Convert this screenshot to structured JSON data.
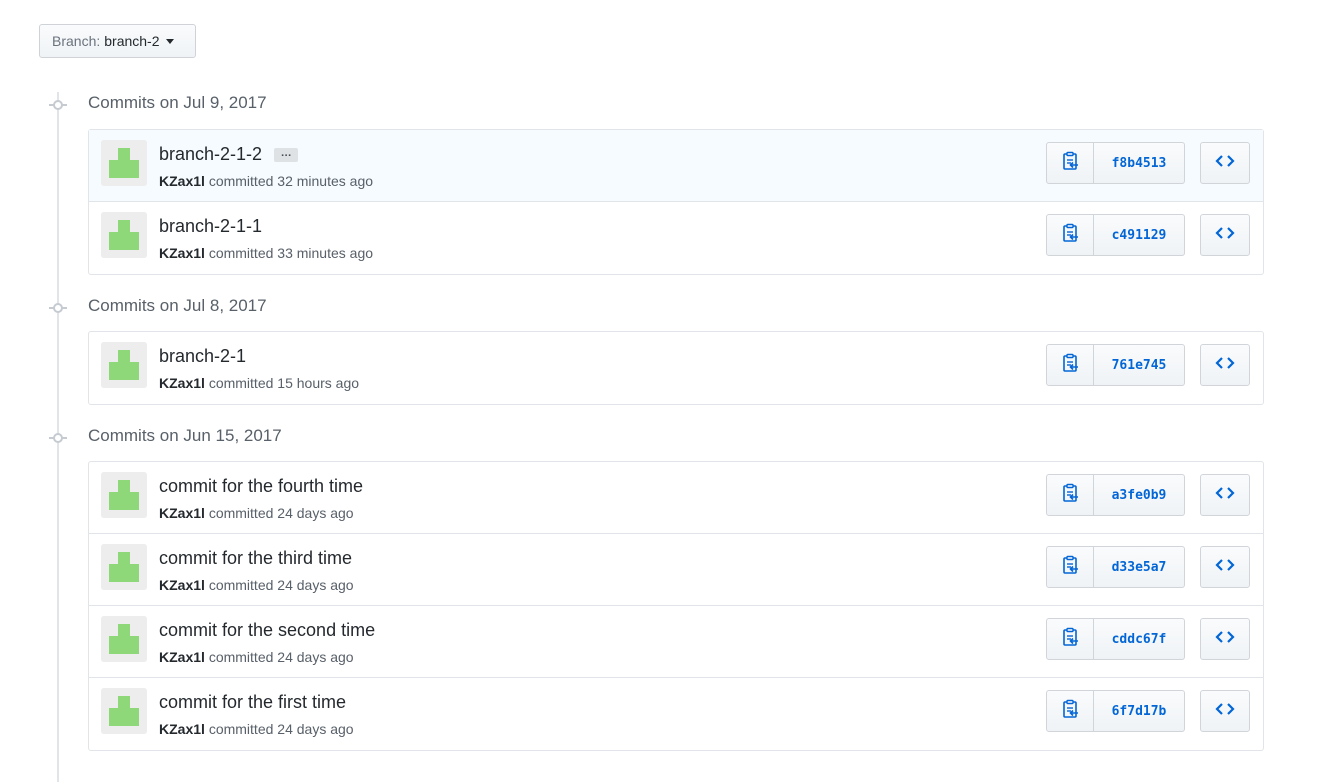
{
  "branch": {
    "label": "Branch:",
    "value": "branch-2"
  },
  "colors": {
    "link": "#0366d6",
    "avatar": "#8fd87a",
    "highlight": "#f6fbff"
  },
  "icons": {
    "copy": "clippy-icon",
    "browse": "code-icon",
    "node": "commit-node-icon",
    "caret": "caret-down-icon"
  },
  "groups": [
    {
      "title": "Commits on Jul 9, 2017",
      "commits": [
        {
          "message": "branch-2-1-2",
          "author": "KZax1l",
          "action": "committed",
          "time": "32 minutes ago",
          "sha": "f8b4513",
          "ellipsis": "…"
        },
        {
          "message": "branch-2-1-1",
          "author": "KZax1l",
          "action": "committed",
          "time": "33 minutes ago",
          "sha": "c491129"
        }
      ]
    },
    {
      "title": "Commits on Jul 8, 2017",
      "commits": [
        {
          "message": "branch-2-1",
          "author": "KZax1l",
          "action": "committed",
          "time": "15 hours ago",
          "sha": "761e745"
        }
      ]
    },
    {
      "title": "Commits on Jun 15, 2017",
      "commits": [
        {
          "message": "commit for the fourth time",
          "author": "KZax1l",
          "action": "committed",
          "time": "24 days ago",
          "sha": "a3fe0b9"
        },
        {
          "message": "commit for the third time",
          "author": "KZax1l",
          "action": "committed",
          "time": "24 days ago",
          "sha": "d33e5a7"
        },
        {
          "message": "commit for the second time",
          "author": "KZax1l",
          "action": "committed",
          "time": "24 days ago",
          "sha": "cddc67f"
        },
        {
          "message": "commit for the first time",
          "author": "KZax1l",
          "action": "committed",
          "time": "24 days ago",
          "sha": "6f7d17b"
        }
      ]
    }
  ]
}
